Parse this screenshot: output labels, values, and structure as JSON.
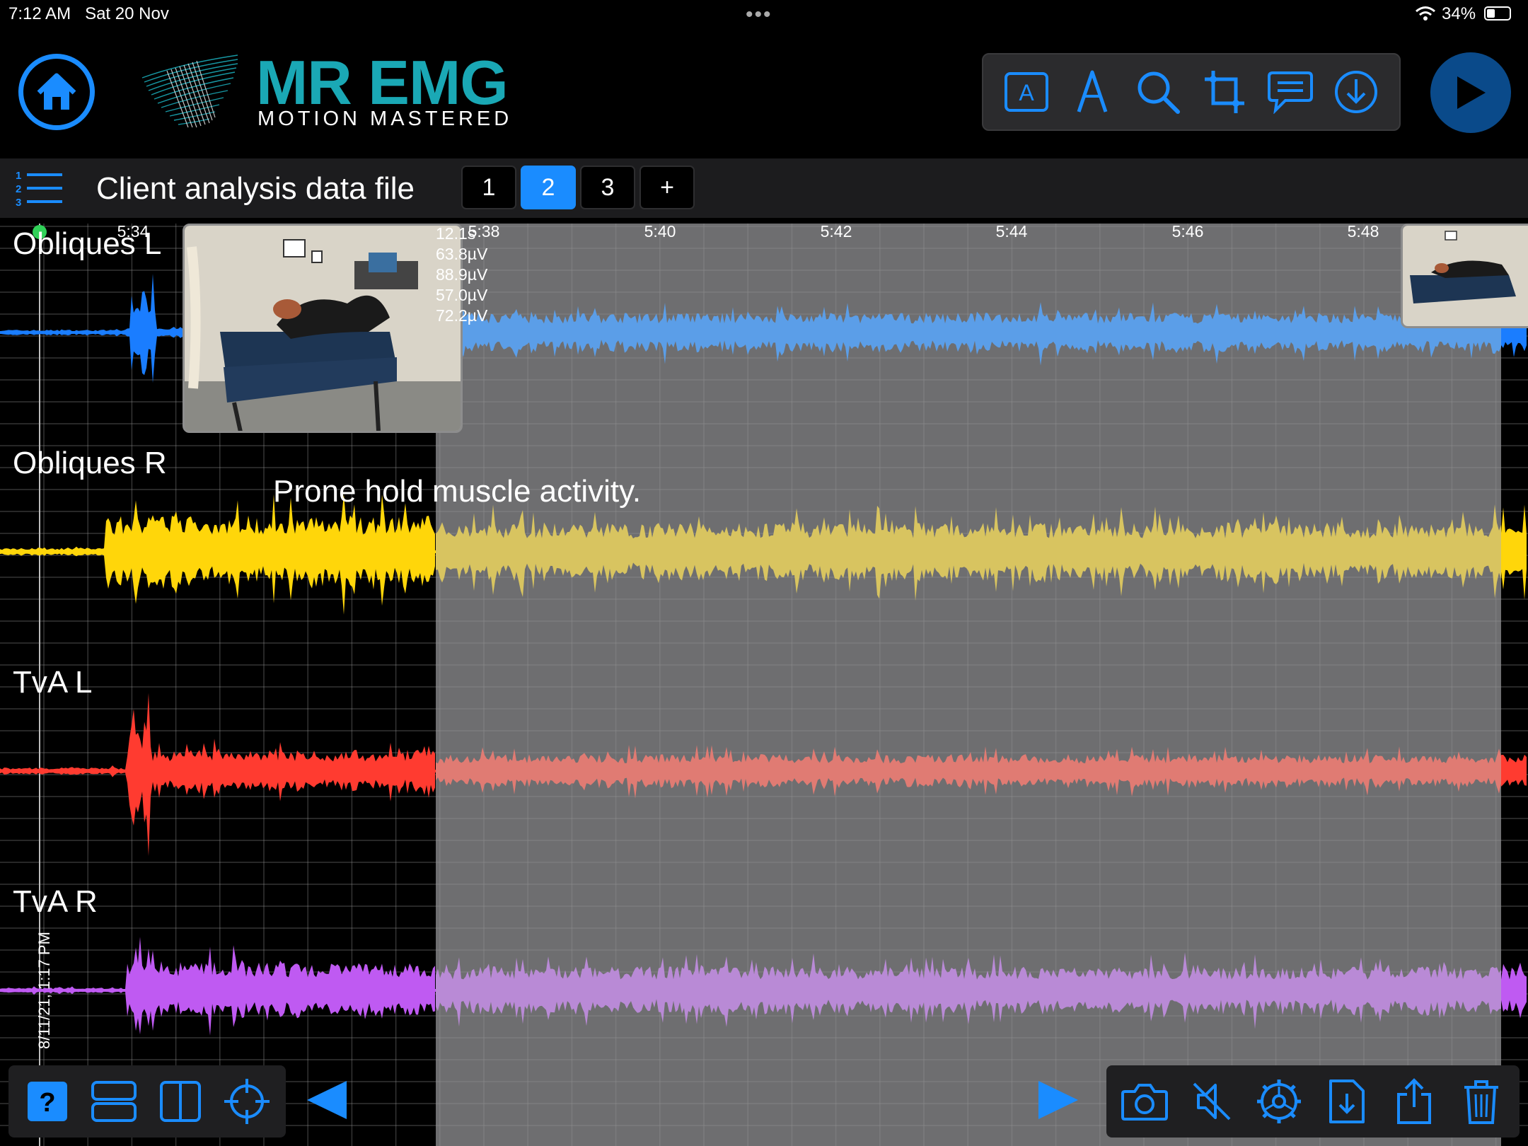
{
  "status_bar": {
    "time": "7:12 AM",
    "date": "Sat 20 Nov",
    "battery": "34%",
    "battery_level": 0.34
  },
  "brand": {
    "title": "MR EMG",
    "subtitle": "MOTION MASTERED"
  },
  "file": {
    "title": "Client analysis data file",
    "pages": [
      "1",
      "2",
      "3",
      "+"
    ],
    "active_page": "2"
  },
  "plot": {
    "time_ticks": [
      "5:34",
      "5:38",
      "5:40",
      "5:42",
      "5:44",
      "5:46",
      "5:48"
    ],
    "readout": [
      "12.1s",
      "63.8µV",
      "88.9µV",
      "57.0µV",
      "72.2µV"
    ],
    "annotation": "Prone hold muscle activity.",
    "session_date": "8/11/21, 1:17 PM",
    "channels": [
      {
        "name": "Obliques L",
        "color": "#1a7dff",
        "selected_color": "#5b9ee8"
      },
      {
        "name": "Obliques R",
        "color": "#ffd60a",
        "selected_color": "#d8c460"
      },
      {
        "name": "TvA L",
        "color": "#ff3b30",
        "selected_color": "#e07b73"
      },
      {
        "name": "TvA R",
        "color": "#bf5af2",
        "selected_color": "#b98ad6"
      }
    ],
    "selection_color": "#6e6e70"
  },
  "icons": {
    "header": [
      "home-icon",
      "text-annotation-icon",
      "pen-icon",
      "search-icon",
      "crop-icon",
      "comment-icon",
      "download-icon",
      "play-icon"
    ],
    "bottom_left": [
      "help-icon",
      "stacked-view-icon",
      "split-view-icon",
      "crosshair-icon"
    ],
    "bottom_right": [
      "camera-icon",
      "mute-icon",
      "settings-icon",
      "file-import-icon",
      "share-icon",
      "trash-icon"
    ]
  },
  "colors": {
    "accent": "#1a8cff",
    "brand": "#1aa8b5"
  }
}
